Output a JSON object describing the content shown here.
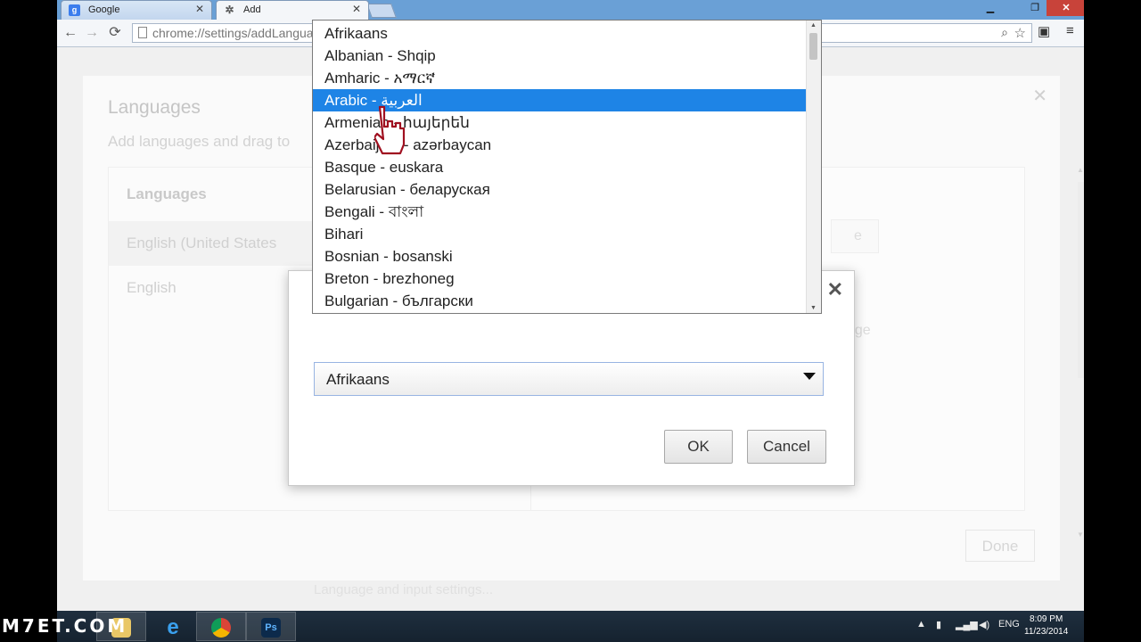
{
  "browser": {
    "tabs": [
      {
        "title": "Google",
        "favicon": "g-favicon-icon"
      },
      {
        "title": "Add",
        "favicon": "gear-favicon-icon"
      }
    ],
    "url": "chrome://settings/addLangua"
  },
  "settings": {
    "title": "Languages",
    "subtitle": "Add languages and drag to",
    "list_header": "Languages",
    "languages": [
      "English (United States",
      "English"
    ],
    "ghost_texts": [
      "e",
      "g",
      "age"
    ],
    "done_label": "Done",
    "footer_text": "Language and input settings..."
  },
  "dialog": {
    "selected_value": "Afrikaans",
    "ok_label": "OK",
    "cancel_label": "Cancel",
    "options": [
      "Afrikaans",
      "Albanian - Shqip",
      "Amharic - አማርኛ",
      "Arabic - العربية",
      "Armenian - հայերեն",
      "Azerbaijani - azərbaycan",
      "Basque - euskara",
      "Belarusian - беларуская",
      "Bengali - বাংলা",
      "Bihari",
      "Bosnian - bosanski",
      "Breton - brezhoneg",
      "Bulgarian - български"
    ],
    "highlighted_option": "Arabic - العربية"
  },
  "taskbar": {
    "language": "ENG",
    "time": "8:09 PM",
    "date": "11/23/2014"
  },
  "watermark": "M7ET.COM",
  "colors": {
    "highlight": "#1e84e6",
    "titlebar": "#6aa0d6",
    "taskbar": "#1b2937"
  }
}
